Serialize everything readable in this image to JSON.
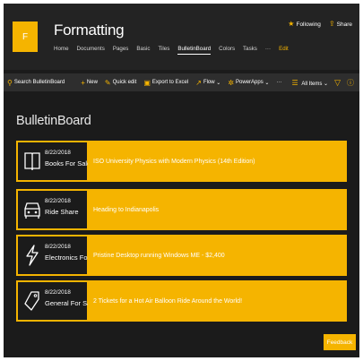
{
  "site": {
    "logo_letter": "F",
    "title": "Formatting",
    "nav": [
      "Home",
      "Documents",
      "Pages",
      "Basic",
      "Tiles",
      "BulletinBoard",
      "Colors",
      "Tasks",
      "···",
      "Edit"
    ],
    "following_label": "Following",
    "share_label": "Share"
  },
  "commandbar": {
    "search_label": "Search BulletinBoard",
    "new_label": "New",
    "quick_edit_label": "Quick edit",
    "export_label": "Export to Excel",
    "flow_label": "Flow",
    "powerapps_label": "PowerApps",
    "more_label": "···",
    "view_label": "All Items"
  },
  "page": {
    "title": "BulletinBoard"
  },
  "items": [
    {
      "date": "8/22/2018",
      "category": "Books For Sale",
      "text": "ISO University Physics with Modern Physics (14th Edition)",
      "icon": "book-icon"
    },
    {
      "date": "8/22/2018",
      "category": "Ride Share",
      "text": "Heading to Indianapolis",
      "icon": "car-icon"
    },
    {
      "date": "8/22/2018",
      "category": "Electronics For S",
      "text": "Pristine Desktop running Windows ME - $2,400",
      "icon": "lightning-icon"
    },
    {
      "date": "8/22/2018",
      "category": "General For Sale",
      "text": "2 Tickets for a Hot Air Balloon Ride Around the World!",
      "icon": "tag-icon"
    }
  ],
  "feedback_label": "Feedback",
  "colors": {
    "accent": "#f5b400",
    "background": "#1b1b1b",
    "header": "#232323",
    "commandbar": "#2e2e2e"
  }
}
